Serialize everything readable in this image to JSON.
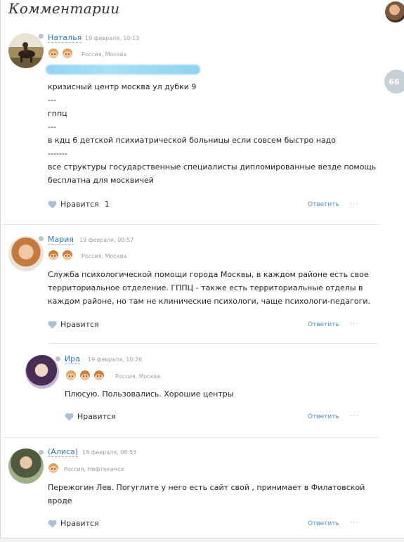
{
  "page": {
    "title": "Комментарии",
    "side_badge": "66"
  },
  "comments": [
    {
      "author": "Наталья",
      "date": "19 февраля, 10:13",
      "location": "Россия, Москва",
      "lines": [
        "кризисный центр москва ул дубки 9",
        "---",
        "гппц",
        "---",
        "в кдц 6 детской психиатрической больницы если совсем быстро надо",
        "-------",
        "все структуры государственные специалисты дипломированные везде помощь",
        "бесплатна для москвичей"
      ],
      "like_label": "Нравится",
      "like_count": "1",
      "reply_label": "Ответить",
      "more": "···"
    },
    {
      "author": "Мария",
      "date": "19 февраля, 08:57",
      "location": "Россия, Москва",
      "lines": [
        "Служба психологической помощи города Москвы, в каждом районе есть свое",
        "территориальное отделение. ГППЦ - также есть территориальные отделы в",
        "каждом районе, но там не клинические психологи, чаще психологи-педагоги."
      ],
      "like_label": "Нравится",
      "reply_label": "Ответить",
      "more": "···"
    },
    {
      "author": "Ира",
      "date": "19 февраля, 10:26",
      "location": "Россия, Москва",
      "lines": [
        "Плюсую. Пользовались. Хорошие центры"
      ],
      "like_label": "Нравится",
      "reply_label": "Ответить",
      "more": "···"
    },
    {
      "author": "(Алиса)",
      "date": "19 февраля, 08:53",
      "location": "Россия, Нефтекамск",
      "lines": [
        "Пережогин Лев. Погуглите у него есть сайт свой , принимает в Филатовской",
        "вроде"
      ],
      "like_label": "Нравится",
      "reply_label": "Ответить",
      "more": "···"
    }
  ],
  "colors": {
    "link": "#2f76b8",
    "reply": "#4a8fc9",
    "muted": "#9aa0a6",
    "heart": "#a9c0d6"
  }
}
